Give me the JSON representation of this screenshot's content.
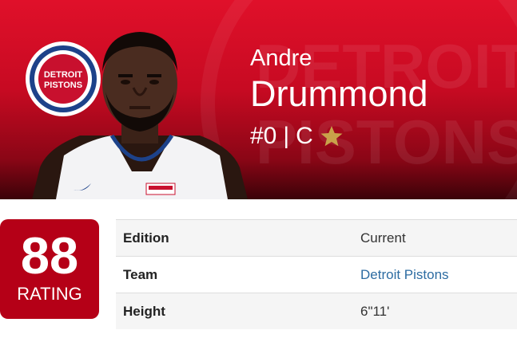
{
  "player": {
    "first_name": "Andre",
    "last_name": "Drummond",
    "number": "#0",
    "separator": "|",
    "position": "C",
    "badge_icon": "star-icon"
  },
  "team_logo": {
    "line1": "DETROIT",
    "line2": "PISTONS"
  },
  "watermark": {
    "line1": "DETROIT",
    "line2": "PISTONS"
  },
  "rating": {
    "value": "88",
    "label": "RATING"
  },
  "info": {
    "rows": [
      {
        "label": "Edition",
        "value": "Current"
      },
      {
        "label": "Team",
        "value": "Detroit Pistons"
      },
      {
        "label": "Height",
        "value": "6\"11'"
      }
    ]
  },
  "colors": {
    "hero_red": "#e0102a",
    "rating_red": "#b50017",
    "link_blue": "#2d6ca2",
    "star_gold": "#c9a24a"
  }
}
